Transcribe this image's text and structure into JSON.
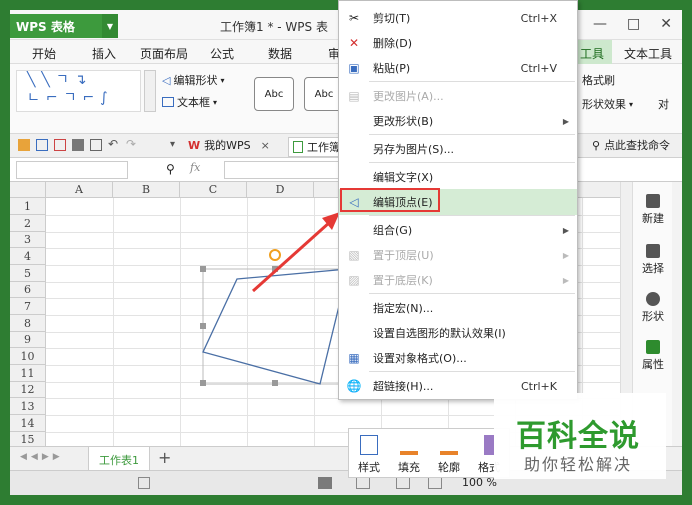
{
  "app": {
    "logo": "WPS 表格",
    "title": "工作簿1 * - WPS 表",
    "win_min": "—",
    "win_max": "□",
    "win_close": "✕"
  },
  "menu": {
    "tabs": [
      "开始",
      "插入",
      "页面布局",
      "公式",
      "数据",
      "审"
    ],
    "context_tab_1": "工具",
    "context_tab_2": "文本工具"
  },
  "ribbon": {
    "edit_shape": "编辑形状",
    "text_box": "文本框",
    "style_1": "Abc",
    "style_2": "Abc",
    "format_painter": "格式刷",
    "shape_effect": "形状效果",
    "right_cut": "对"
  },
  "qat": {
    "my_wps": "我的WPS",
    "workbook_tab": "工作簿",
    "search": "点此查找命令"
  },
  "formula": {
    "fx": "fx"
  },
  "grid": {
    "columns": [
      "A",
      "B",
      "C",
      "D"
    ],
    "rows": [
      "1",
      "2",
      "3",
      "4",
      "5",
      "6",
      "7",
      "8",
      "9",
      "10",
      "11",
      "12",
      "13",
      "14",
      "15"
    ]
  },
  "context_menu": {
    "items": [
      {
        "label": "剪切(T)",
        "shortcut": "Ctrl+X",
        "icon": "scissors-icon"
      },
      {
        "label": "删除(D)",
        "shortcut": "",
        "icon": "delete-x-icon"
      },
      {
        "label": "粘贴(P)",
        "shortcut": "Ctrl+V",
        "icon": "paste-icon"
      },
      {
        "label": "更改图片(A)...",
        "shortcut": "",
        "icon": "change-image-icon"
      },
      {
        "label": "更改形状(B)",
        "shortcut": "",
        "icon": ""
      },
      {
        "label": "另存为图片(S)...",
        "shortcut": "",
        "icon": ""
      },
      {
        "label": "编辑文字(X)",
        "shortcut": "",
        "icon": ""
      },
      {
        "label": "编辑顶点(E)",
        "shortcut": "",
        "icon": "edit-points-icon"
      },
      {
        "label": "组合(G)",
        "shortcut": "",
        "icon": ""
      },
      {
        "label": "置于顶层(U)",
        "shortcut": "",
        "icon": "bring-to-front-icon"
      },
      {
        "label": "置于底层(K)",
        "shortcut": "",
        "icon": "send-to-back-icon"
      },
      {
        "label": "指定宏(N)...",
        "shortcut": "",
        "icon": ""
      },
      {
        "label": "设置自选图形的默认效果(I)",
        "shortcut": "",
        "icon": ""
      },
      {
        "label": "设置对象格式(O)...",
        "shortcut": "",
        "icon": "format-object-icon"
      },
      {
        "label": "超链接(H)...",
        "shortcut": "Ctrl+K",
        "icon": "hyperlink-icon"
      }
    ]
  },
  "side_panel": {
    "items": [
      "新建",
      "选择",
      "形状",
      "属性"
    ]
  },
  "sheet": {
    "tab": "工作表1",
    "add": "+"
  },
  "status": {
    "zoom": "100 %"
  },
  "mini_toolbar": {
    "items": [
      "样式",
      "填充",
      "轮廓",
      "格式"
    ]
  },
  "watermark": {
    "title": "百科全说",
    "subtitle": "助你轻松解决"
  },
  "colors": {
    "brand_green": "#3d9a3d",
    "highlight": "#d5ecd5",
    "red_annotation": "#e53935",
    "shape_stroke": "#4a6fa5"
  }
}
